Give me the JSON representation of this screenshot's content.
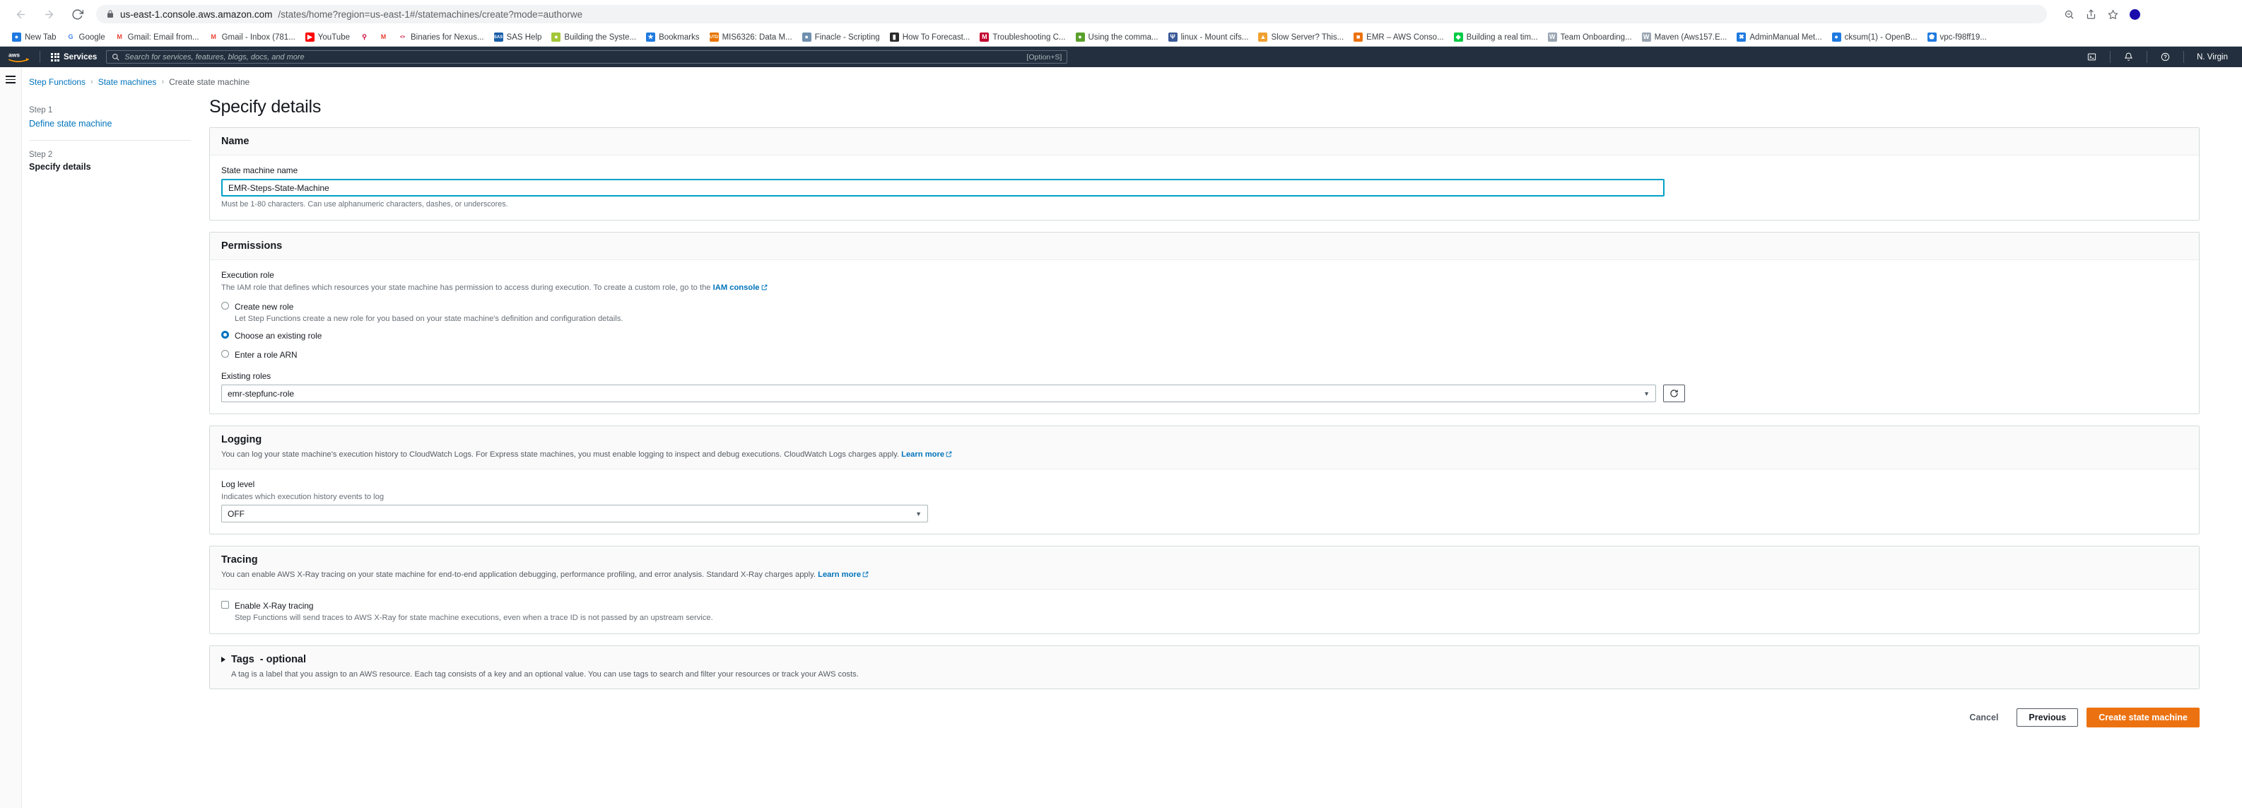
{
  "browser": {
    "nav": {
      "back": "←",
      "forward": "→",
      "reload": "⟳"
    },
    "url_strong": "us-east-1.console.aws.amazon.com",
    "url_dim": "/states/home?region=us-east-1#/statemachines/create?mode=authorwe",
    "omnibox_icons": [
      "lock-icon",
      "zoom-out-icon",
      "share-icon",
      "bookmark-star-icon",
      "profile-avatar"
    ],
    "bookmarks": [
      {
        "label": "New Tab",
        "icon": "globe-icon",
        "color": "#1f7ae0",
        "glyph": "●"
      },
      {
        "label": "Google",
        "icon": "google-icon",
        "color": "#ffffff",
        "glyph": "G"
      },
      {
        "label": "Gmail: Email from...",
        "icon": "gmail-icon",
        "color": "#ffffff",
        "glyph": "M"
      },
      {
        "label": "Gmail - Inbox (781...",
        "icon": "gmail-icon",
        "color": "#ffffff",
        "glyph": "M"
      },
      {
        "label": "YouTube",
        "icon": "youtube-icon",
        "color": "#ff0000",
        "glyph": "▶"
      },
      {
        "label": "",
        "icon": "search-icon",
        "color": "#ffffff",
        "glyph": "⚲"
      },
      {
        "label": "",
        "icon": "gmail-icon",
        "color": "#ffffff",
        "glyph": "M"
      },
      {
        "label": "Binaries for Nexus...",
        "icon": "code-icon",
        "color": "#ffffff",
        "glyph": "<>"
      },
      {
        "label": "SAS Help",
        "icon": "sas-icon",
        "color": "#1a5ea8",
        "glyph": "SAS"
      },
      {
        "label": "Building the Syste...",
        "icon": "android-icon",
        "color": "#a4c639",
        "glyph": "●"
      },
      {
        "label": "Bookmarks",
        "icon": "star-icon",
        "color": "#1f7ae0",
        "glyph": "★"
      },
      {
        "label": "MIS6326: Data M...",
        "icon": "utd-icon",
        "color": "#e87500",
        "glyph": "UTD"
      },
      {
        "label": "Finacle - Scripting",
        "icon": "person-icon",
        "color": "#6f8fae",
        "glyph": "●"
      },
      {
        "label": "How To Forecast...",
        "icon": "book-icon",
        "color": "#2b2b2b",
        "glyph": "▮"
      },
      {
        "label": "Troubleshooting C...",
        "icon": "medium-icon",
        "color": "#c3002f",
        "glyph": "M"
      },
      {
        "label": "Using the comma...",
        "icon": "elephant-icon",
        "color": "#5aa02c",
        "glyph": "●"
      },
      {
        "label": "linux - Mount cifs...",
        "icon": "stack-exchange-icon",
        "color": "#3b5998",
        "glyph": "Ψ"
      },
      {
        "label": "Slow Server? This...",
        "icon": "flame-icon",
        "color": "#f0a030",
        "glyph": "▲"
      },
      {
        "label": "EMR – AWS Conso...",
        "icon": "aws-box-icon",
        "color": "#ec7211",
        "glyph": "■"
      },
      {
        "label": "Building a real tim...",
        "icon": "green-icon",
        "color": "#00cc44",
        "glyph": "◆"
      },
      {
        "label": "Team Onboarding...",
        "icon": "wiki-icon",
        "color": "#9aa5b1",
        "glyph": "W"
      },
      {
        "label": "Maven (Aws157.E...",
        "icon": "wiki-icon",
        "color": "#9aa5b1",
        "glyph": "W"
      },
      {
        "label": "AdminManual Met...",
        "icon": "x-icon",
        "color": "#1f7ae0",
        "glyph": "✖"
      },
      {
        "label": "cksum(1) - OpenB...",
        "icon": "globe-icon",
        "color": "#1f7ae0",
        "glyph": "●"
      },
      {
        "label": "vpc-f98ff19...",
        "icon": "aws-vpc-icon",
        "color": "#1f7ae0",
        "glyph": "⬟"
      }
    ]
  },
  "aws_header": {
    "logo_alt": "aws",
    "services_label": "Services",
    "search_placeholder": "Search for services, features, blogs, docs, and more",
    "search_value": "",
    "search_shortcut": "[Option+S]",
    "right_icons": [
      "cloudshell-icon",
      "bell-icon",
      "help-icon"
    ],
    "region_label": "N. Virgin"
  },
  "breadcrumb": {
    "items": [
      {
        "label": "Step Functions",
        "current": false
      },
      {
        "label": "State machines",
        "current": false
      },
      {
        "label": "Create state machine",
        "current": true
      }
    ],
    "separator": "›"
  },
  "steps_nav": [
    {
      "number": "Step 1",
      "label": "Define state machine",
      "current": false
    },
    {
      "number": "Step 2",
      "label": "Specify details",
      "current": true
    }
  ],
  "page": {
    "title": "Specify details"
  },
  "name_panel": {
    "title": "Name",
    "field_label": "State machine name",
    "field_value": "EMR-Steps-State-Machine",
    "field_placeholder": "",
    "hint": "Must be 1-80 characters. Can use alphanumeric characters, dashes, or underscores."
  },
  "permissions_panel": {
    "title": "Permissions",
    "execution_role_label": "Execution role",
    "execution_role_desc_pre": "The IAM role that defines which resources your state machine has permission to access during execution. To create a custom role, go to the ",
    "execution_role_link": "IAM console",
    "options": [
      {
        "label": "Create new role",
        "desc": "Let Step Functions create a new role for you based on your state machine's definition and configuration details.",
        "selected": false
      },
      {
        "label": "Choose an existing role",
        "desc": "",
        "selected": true
      },
      {
        "label": "Enter a role ARN",
        "desc": "",
        "selected": false
      }
    ],
    "existing_roles_label": "Existing roles",
    "existing_roles_value": "emr-stepfunc-role",
    "refresh_icon": "refresh-icon"
  },
  "logging_panel": {
    "title": "Logging",
    "desc_pre": "You can log your state machine's execution history to CloudWatch Logs. For Express state machines, you must enable logging to inspect and debug executions. CloudWatch Logs charges apply. ",
    "desc_link": "Learn more",
    "log_level_label": "Log level",
    "log_level_sublabel": "Indicates which execution history events to log",
    "log_level_value": "OFF"
  },
  "tracing_panel": {
    "title": "Tracing",
    "desc_pre": "You can enable AWS X-Ray tracing on your state machine for end-to-end application debugging, performance profiling, and error analysis. Standard X-Ray charges apply. ",
    "desc_link": "Learn more",
    "checkbox_label": "Enable X-Ray tracing",
    "checkbox_desc": "Step Functions will send traces to AWS X-Ray for state machine executions, even when a trace ID is not passed by an upstream service.",
    "checkbox_checked": false
  },
  "tags_panel": {
    "title": "Tags",
    "optional_suffix": "- optional",
    "desc": "A tag is a label that you assign to an AWS resource. Each tag consists of a key and an optional value. You can use tags to search and filter your resources or track your AWS costs.",
    "expanded": false
  },
  "actions": {
    "cancel": "Cancel",
    "previous": "Previous",
    "create": "Create state machine"
  },
  "colors": {
    "aws_header_bg": "#232f3e",
    "primary_orange": "#ec7211",
    "link_blue": "#0073bb",
    "focus_teal": "#00a1c9"
  }
}
